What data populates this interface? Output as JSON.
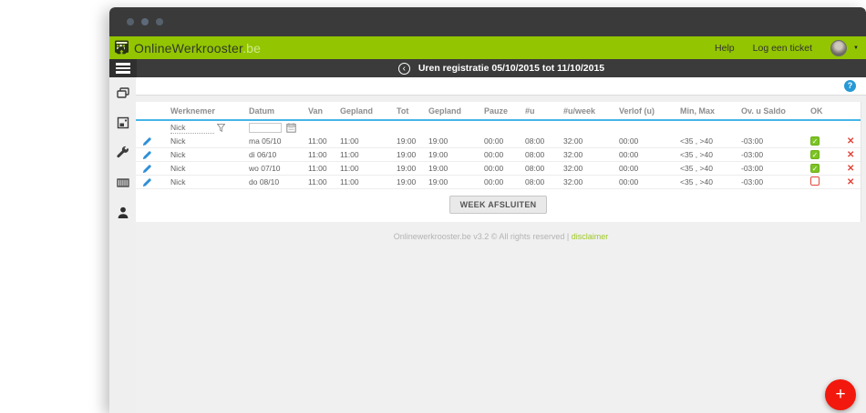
{
  "header": {
    "brand": "OnlineWerkrooster",
    "brand_suffix": ".be",
    "help_label": "Help",
    "ticket_label": "Log een ticket"
  },
  "titlebar": {
    "title": "Uren registratie 05/10/2015 tot 11/10/2015"
  },
  "sidebar": {
    "icons": [
      "screens-icon",
      "image-icon",
      "wrench-icon",
      "schedule-icon",
      "user-icon"
    ]
  },
  "icons": {
    "back": "‹",
    "help": "?",
    "caret": "▼",
    "check": "✓",
    "delete": "✕",
    "plus": "+"
  },
  "table": {
    "columns": [
      "Werknemer",
      "Datum",
      "Van",
      "Gepland",
      "Tot",
      "Gepland",
      "Pauze",
      "#u",
      "#u/week",
      "Verlof (u)",
      "Min, Max",
      "Ov. u Saldo",
      "OK"
    ],
    "filter": {
      "werknemer": "Nick",
      "datum": ""
    },
    "rows": [
      {
        "werknemer": "Nick",
        "datum": "ma 05/10",
        "van": "11:00",
        "gepland_van": "11:00",
        "tot": "19:00",
        "gepland_tot": "19:00",
        "pauze": "00:00",
        "u": "08:00",
        "u_week": "32:00",
        "verlof": "00:00",
        "min_max": "<35 , >40",
        "saldo": "-03:00",
        "ok": true
      },
      {
        "werknemer": "Nick",
        "datum": "di 06/10",
        "van": "11:00",
        "gepland_van": "11:00",
        "tot": "19:00",
        "gepland_tot": "19:00",
        "pauze": "00:00",
        "u": "08:00",
        "u_week": "32:00",
        "verlof": "00:00",
        "min_max": "<35 , >40",
        "saldo": "-03:00",
        "ok": true
      },
      {
        "werknemer": "Nick",
        "datum": "wo 07/10",
        "van": "11:00",
        "gepland_van": "11:00",
        "tot": "19:00",
        "gepland_tot": "19:00",
        "pauze": "00:00",
        "u": "08:00",
        "u_week": "32:00",
        "verlof": "00:00",
        "min_max": "<35 , >40",
        "saldo": "-03:00",
        "ok": true
      },
      {
        "werknemer": "Nick",
        "datum": "do 08/10",
        "van": "11:00",
        "gepland_van": "11:00",
        "tot": "19:00",
        "gepland_tot": "19:00",
        "pauze": "00:00",
        "u": "08:00",
        "u_week": "32:00",
        "verlof": "00:00",
        "min_max": "<35 , >40",
        "saldo": "-03:00",
        "ok": false
      }
    ],
    "close_week_label": "WEEK AFSLUITEN"
  },
  "footer": {
    "text": "Onlinewerkrooster.be v3.2 © All rights reserved | ",
    "link": "disclaimer"
  },
  "colors": {
    "header_green": "#93c501",
    "dark_bar": "#3a3a3a",
    "blue_divider": "#46b5e8",
    "check_green": "#7cc325",
    "error_red": "#e0443a",
    "fab_red": "#f2180d",
    "link_green": "#9fc927",
    "help_blue": "#2699d6"
  }
}
